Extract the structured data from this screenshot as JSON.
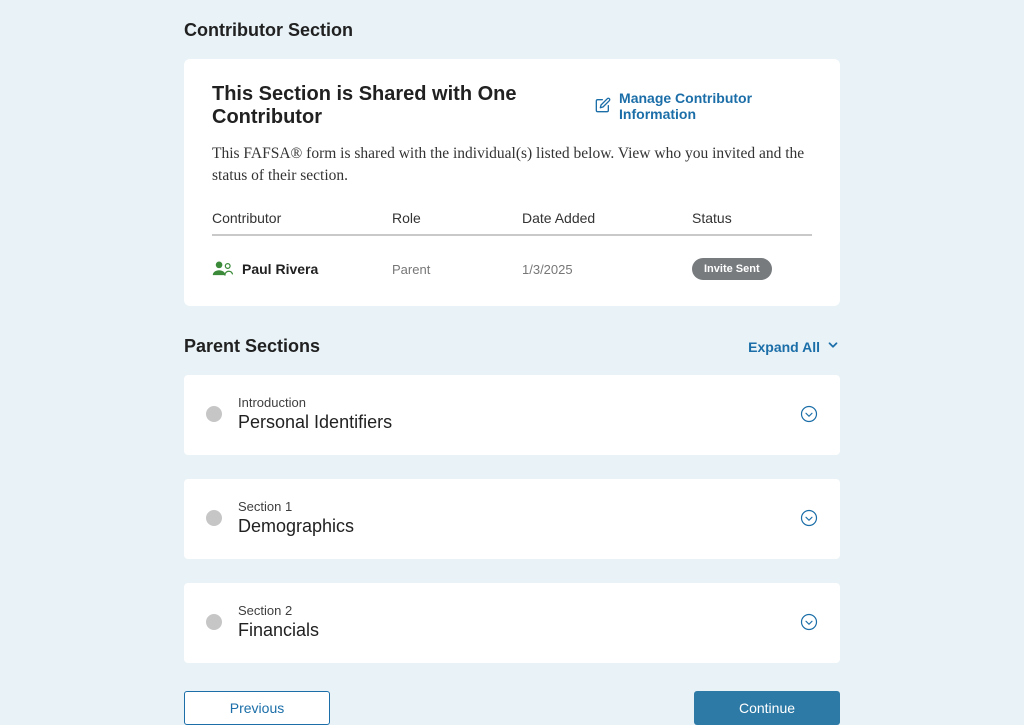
{
  "contributorSection": {
    "heading": "Contributor Section",
    "card": {
      "title": "This Section is Shared with One Contributor",
      "manageLinkLabel": "Manage Contributor Information",
      "description": "This FAFSA® form is shared with the individual(s) listed below. View who you invited and the status of their section.",
      "columns": {
        "contributor": "Contributor",
        "role": "Role",
        "dateAdded": "Date Added",
        "status": "Status"
      },
      "rows": [
        {
          "name": "Paul Rivera",
          "role": "Parent",
          "dateAdded": "1/3/2025",
          "statusBadge": "Invite Sent"
        }
      ]
    }
  },
  "parentSections": {
    "heading": "Parent Sections",
    "expandAllLabel": "Expand All",
    "items": [
      {
        "overline": "Introduction",
        "title": "Personal Identifiers"
      },
      {
        "overline": "Section 1",
        "title": "Demographics"
      },
      {
        "overline": "Section 2",
        "title": "Financials"
      }
    ]
  },
  "nav": {
    "previous": "Previous",
    "continue": "Continue"
  }
}
